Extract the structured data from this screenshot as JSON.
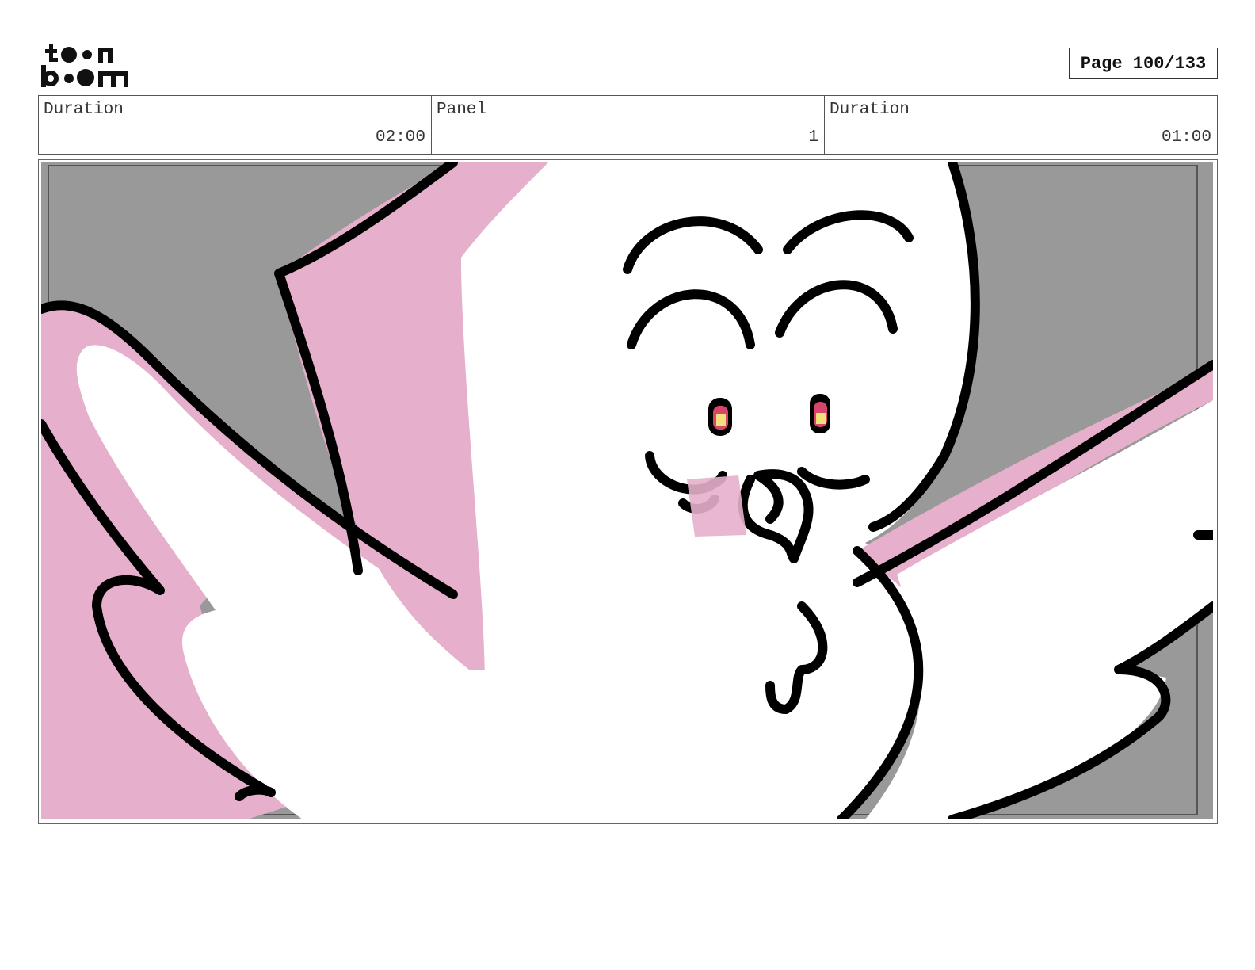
{
  "logo": {
    "line1": "toon",
    "line2": "boom"
  },
  "page": {
    "label": "Page 100/133"
  },
  "info": {
    "cells": [
      {
        "label": "Duration",
        "value": "02:00"
      },
      {
        "label": "Panel",
        "value": "1"
      },
      {
        "label": "Duration",
        "value": "01:00"
      }
    ]
  },
  "panel": {
    "description_icons": [
      "pigeon-character-drawing"
    ],
    "colors": {
      "background": "#999999",
      "character": "#ffffff",
      "shadow": "#e6afcb",
      "outline": "#000000",
      "eye_iris": "#d8456a",
      "eye_highlight": "#f4e07a"
    }
  }
}
